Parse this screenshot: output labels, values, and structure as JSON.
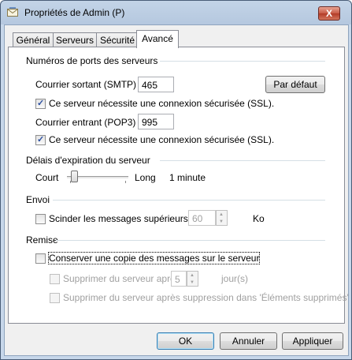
{
  "window": {
    "title": "Propriétés de Admin (P)",
    "close_label": "X",
    "app_icon": "mail-account-icon"
  },
  "tabs": [
    {
      "label": "Général",
      "active": false
    },
    {
      "label": "Serveurs",
      "active": false
    },
    {
      "label": "Sécurité",
      "active": false
    },
    {
      "label": "Avancé",
      "active": true
    }
  ],
  "ports": {
    "group_label": "Numéros de ports des serveurs",
    "smtp_label": "Courrier sortant (SMTP) :",
    "smtp_value": "465",
    "default_button": "Par défaut",
    "smtp_ssl_label": "Ce serveur nécessite une connexion sécurisée (SSL).",
    "smtp_ssl_checked": true,
    "pop3_label": "Courrier entrant (POP3) :",
    "pop3_value": "995",
    "pop3_ssl_label": "Ce serveur nécessite une connexion sécurisée (SSL).",
    "pop3_ssl_checked": true
  },
  "timeout": {
    "group_label": "Délais d'expiration du serveur",
    "short_label": "Court",
    "long_label": "Long",
    "value_label": "1 minute",
    "slider_level": 0.12
  },
  "send": {
    "group_label": "Envoi",
    "split_label": "Scinder les messages supérieurs à",
    "split_checked": false,
    "split_value": "60",
    "unit_label": "Ko"
  },
  "delivery": {
    "group_label": "Remise",
    "keep_copy_label": "Conserver une copie des messages sur le serveur",
    "keep_copy_checked": false,
    "remove_after_label": "Supprimer du serveur après",
    "remove_after_value": "5",
    "days_label": "jour(s)",
    "remove_deleted_label": "Supprimer du serveur après suppression dans 'Éléments supprimés'"
  },
  "buttons": {
    "ok": "OK",
    "cancel": "Annuler",
    "apply": "Appliquer"
  },
  "colors": {
    "title_bar": "#b5c8df",
    "close_button": "#c75a45",
    "dialog_bg": "#f0f0f0",
    "checkbox_mark": "#2b4fa0"
  }
}
